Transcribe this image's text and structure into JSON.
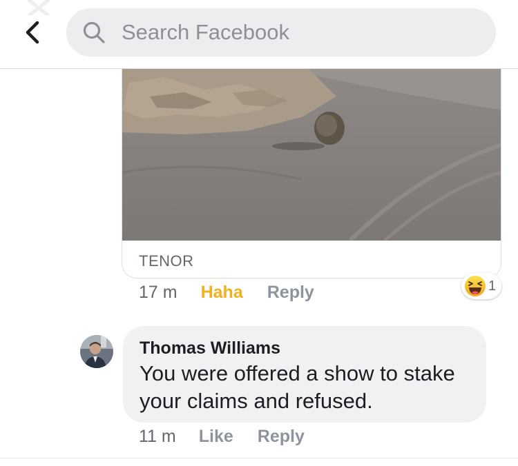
{
  "header": {
    "search_placeholder": "Search Facebook"
  },
  "gif_comment": {
    "source_label": "TENOR",
    "timestamp": "17 m",
    "reaction_label": "Haha",
    "reply_label": "Reply",
    "reaction_count": "1"
  },
  "comment": {
    "author": "Thomas Williams",
    "text": "You were offered a show to stake your claims and refused.",
    "timestamp": "11 m",
    "like_label": "Like",
    "reply_label": "Reply"
  },
  "colors": {
    "haha_accent": "#f2b021",
    "bubble_bg": "#f0f1f3",
    "search_bg": "#ededf0"
  },
  "icons": [
    "back-arrow-icon",
    "search-icon",
    "haha-reaction-icon",
    "close-icon"
  ]
}
